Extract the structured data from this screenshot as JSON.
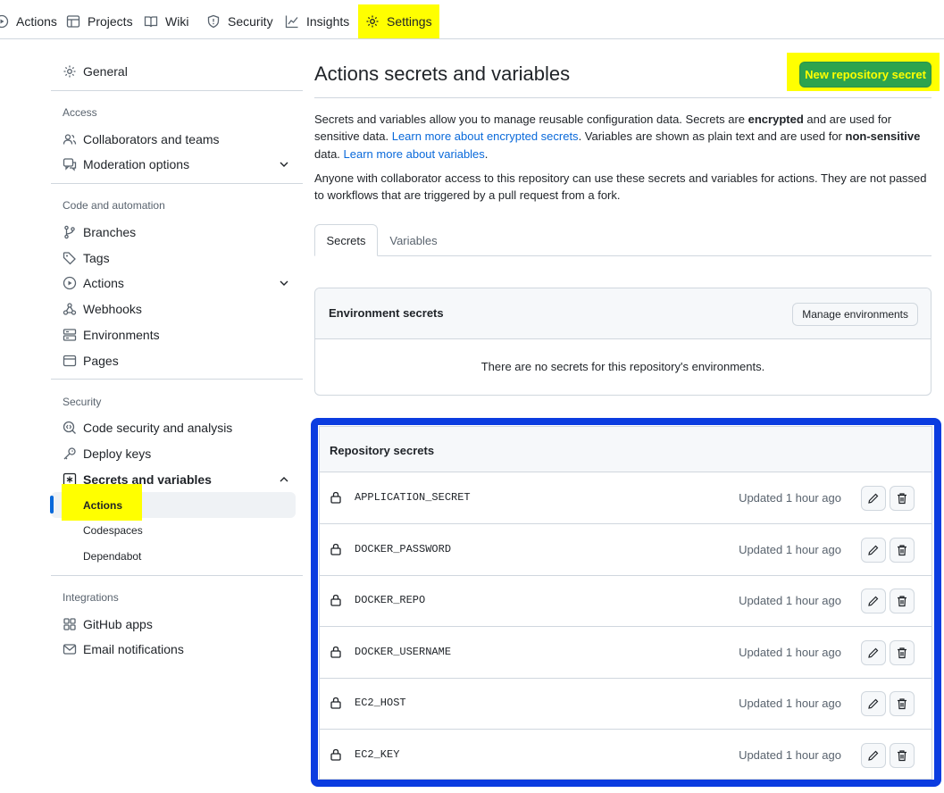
{
  "nav": {
    "items": [
      {
        "label": "Actions",
        "icon": "play-icon"
      },
      {
        "label": "Projects",
        "icon": "table-icon"
      },
      {
        "label": "Wiki",
        "icon": "book-icon"
      },
      {
        "label": "Security",
        "icon": "shield-icon"
      },
      {
        "label": "Insights",
        "icon": "graph-icon"
      },
      {
        "label": "Settings",
        "icon": "gear-icon"
      }
    ]
  },
  "sidebar": {
    "general": "General",
    "groups": {
      "access": "Access",
      "code_automation": "Code and automation",
      "security": "Security",
      "integrations": "Integrations"
    },
    "items": {
      "collaborators": "Collaborators and teams",
      "moderation": "Moderation options",
      "branches": "Branches",
      "tags": "Tags",
      "actions": "Actions",
      "webhooks": "Webhooks",
      "environments": "Environments",
      "pages": "Pages",
      "code_security": "Code security and analysis",
      "deploy_keys": "Deploy keys",
      "secrets_variables": "Secrets and variables",
      "sub_actions": "Actions",
      "sub_codespaces": "Codespaces",
      "sub_dependabot": "Dependabot",
      "github_apps": "GitHub apps",
      "email_notifications": "Email notifications"
    }
  },
  "main": {
    "title": "Actions secrets and variables",
    "new_secret_button": "New repository secret",
    "intro": {
      "p1_a": "Secrets and variables allow you to manage reusable configuration data. Secrets are ",
      "p1_b": "encrypted",
      "p1_c": " and are used for sensitive data. ",
      "p1_link1": "Learn more about encrypted secrets",
      "p1_d": ". Variables are shown as plain text and are used for ",
      "p1_e": "non-sensitive",
      "p1_f": " data. ",
      "p1_link2": "Learn more about variables",
      "p1_g": ".",
      "p2": "Anyone with collaborator access to this repository can use these secrets and variables for actions. They are not passed to workflows that are triggered by a pull request from a fork."
    },
    "tabs": [
      "Secrets",
      "Variables"
    ],
    "environment_secrets": {
      "title": "Environment secrets",
      "manage_button": "Manage environments",
      "empty_text": "There are no secrets for this repository's environments."
    },
    "repository_secrets": {
      "title": "Repository secrets",
      "rows": [
        {
          "name": "APPLICATION_SECRET",
          "updated": "Updated 1 hour ago"
        },
        {
          "name": "DOCKER_PASSWORD",
          "updated": "Updated 1 hour ago"
        },
        {
          "name": "DOCKER_REPO",
          "updated": "Updated 1 hour ago"
        },
        {
          "name": "DOCKER_USERNAME",
          "updated": "Updated 1 hour ago"
        },
        {
          "name": "EC2_HOST",
          "updated": "Updated 1 hour ago"
        },
        {
          "name": "EC2_KEY",
          "updated": "Updated 1 hour ago"
        }
      ]
    }
  },
  "colors": {
    "highlight": "#ffff00",
    "primary_button": "#2da44e",
    "annotation_frame": "#0b3ce0",
    "link": "#0969da",
    "active_indicator": "#0969da"
  }
}
